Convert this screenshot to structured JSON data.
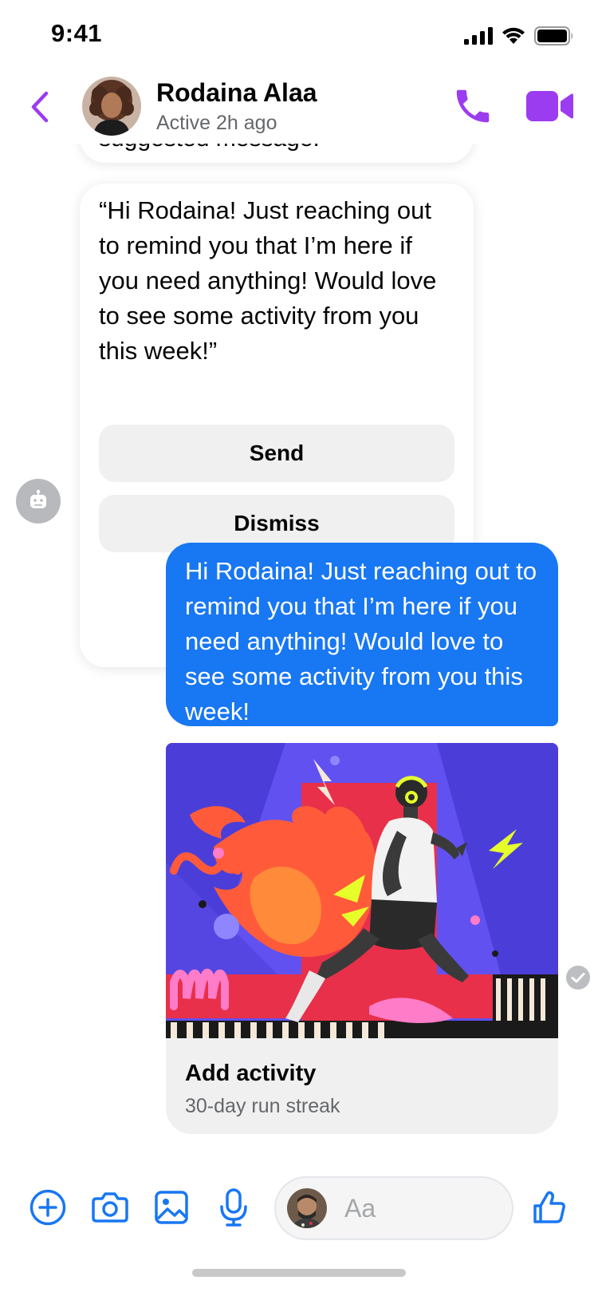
{
  "status_bar": {
    "time": "9:41"
  },
  "header": {
    "contact_name": "Rodaina Alaa",
    "contact_status": "Active 2h ago",
    "accent_color": "#9b3cf0"
  },
  "chat": {
    "previous_card_text": "suggested message.",
    "suggestion": {
      "text": "“Hi Rodaina! Just reaching out to remind you that I’m here if you need anything! Would love to see some activity from you this week!”",
      "send_label": "Send",
      "dismiss_label": "Dismiss"
    },
    "sent_message": {
      "text": "Hi Rodaina! Just reaching out to remind you that I’m here if you need anything! Would love to see some activity from you this week!",
      "bubble_color": "#1877f2"
    },
    "activity_card": {
      "title": "Add activity",
      "subtitle": "30-day run streak"
    }
  },
  "composer": {
    "placeholder": "Aa",
    "icon_color": "#1877f2"
  }
}
